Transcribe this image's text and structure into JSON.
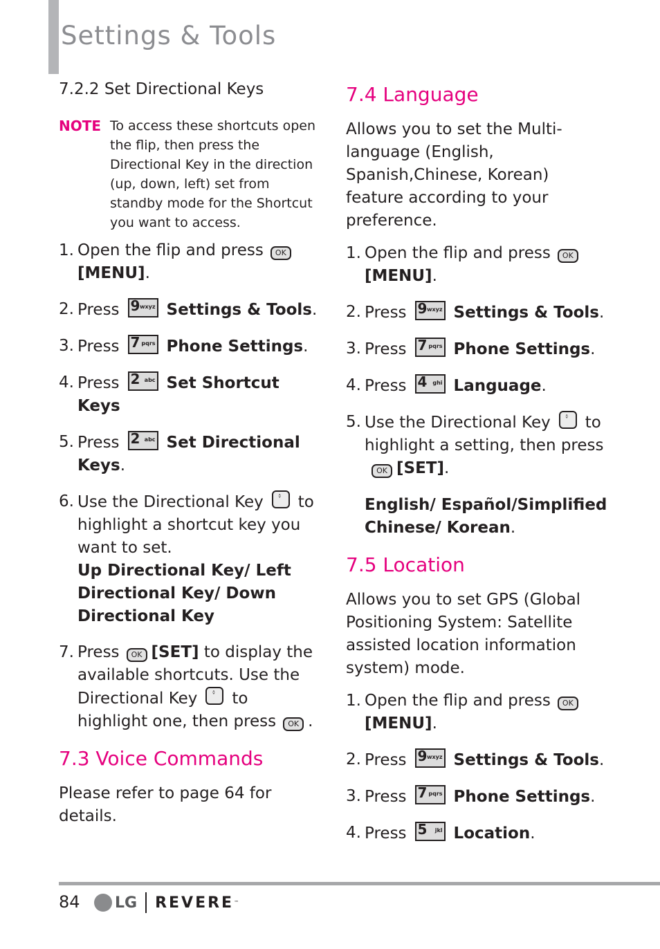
{
  "header": {
    "title": "Settings & Tools"
  },
  "left": {
    "subheading": "7.2.2 Set Directional Keys",
    "note": {
      "label": "NOTE",
      "text": "To access these shortcuts open the flip, then press the Directional Key in the direction (up, down, left) set from standby mode for the Shortcut you want to access."
    },
    "steps": [
      {
        "num": "1.",
        "pre": "Open the flip and press",
        "ok": "OK",
        "bold": "[MENU]",
        "post": "."
      },
      {
        "num": "2.",
        "pre": "Press",
        "key_digit": "9",
        "key_letters": "wxyz",
        "bold": "Settings & Tools",
        "post": "."
      },
      {
        "num": "3.",
        "pre": "Press",
        "key_digit": "7",
        "key_letters": "pqrs",
        "bold": "Phone Settings",
        "post": "."
      },
      {
        "num": "4.",
        "pre": "Press",
        "key_digit": "2",
        "key_letters": "abc",
        "bold": "Set Shortcut Keys",
        "post": ""
      },
      {
        "num": "5.",
        "pre": "Press",
        "key_digit": "2",
        "key_letters": "abc",
        "bold": "Set Directional Keys",
        "post": "."
      },
      {
        "num": "6.",
        "pre": "Use the Directional Key",
        "post": "to highlight a shortcut key you want to set.",
        "bold": "Up Directional Key/ Left Directional Key/ Down Directional Key"
      },
      {
        "num": "7.",
        "pre": "Press",
        "ok": "OK",
        "bold": "[SET]",
        "mid": "to display the available shortcuts. Use the Directional Key",
        "mid2": "to highlight one, then press",
        "post": "."
      }
    ],
    "voice": {
      "heading": "7.3 Voice Commands",
      "text": "Please refer to page 64 for details."
    }
  },
  "right": {
    "language": {
      "heading": "7.4 Language",
      "intro": "Allows you to set the Multi-language (English, Spanish,Chinese, Korean) feature according to your preference.",
      "steps": [
        {
          "num": "1.",
          "pre": "Open the flip and press",
          "ok": "OK",
          "bold": "[MENU]",
          "post": "."
        },
        {
          "num": "2.",
          "pre": "Press",
          "key_digit": "9",
          "key_letters": "wxyz",
          "bold": "Settings & Tools",
          "post": "."
        },
        {
          "num": "3.",
          "pre": "Press",
          "key_digit": "7",
          "key_letters": "pqrs",
          "bold": "Phone Settings",
          "post": "."
        },
        {
          "num": "4.",
          "pre": "Press",
          "key_digit": "4",
          "key_letters": "ghi",
          "bold": "Language",
          "post": "."
        },
        {
          "num": "5.",
          "pre": "Use the Directional Key",
          "mid": "to highlight a setting, then press",
          "ok": "OK",
          "bold": "[SET]",
          "post": ".",
          "options": "English/ Español/Simplified Chinese/ Korean",
          "options_post": "."
        }
      ]
    },
    "location": {
      "heading": "7.5 Location",
      "intro": "Allows you to set GPS (Global Positioning System: Satellite assisted location information system) mode.",
      "steps": [
        {
          "num": "1.",
          "pre": "Open the flip and press",
          "ok": "OK",
          "bold": "[MENU]",
          "post": "."
        },
        {
          "num": "2.",
          "pre": "Press",
          "key_digit": "9",
          "key_letters": "wxyz",
          "bold": "Settings & Tools",
          "post": "."
        },
        {
          "num": "3.",
          "pre": "Press",
          "key_digit": "7",
          "key_letters": "pqrs",
          "bold": "Phone Settings",
          "post": "."
        },
        {
          "num": "4.",
          "pre": "Press",
          "key_digit": "5",
          "key_letters": "jkl",
          "bold": "Location",
          "post": "."
        }
      ]
    }
  },
  "footer": {
    "page_number": "84",
    "brand": "LG",
    "product": "REVERE",
    "trademark": "™"
  },
  "colors": {
    "accent": "#e5007e",
    "header_bar": "#b4b5b8",
    "title_gray": "#8c8d91"
  }
}
